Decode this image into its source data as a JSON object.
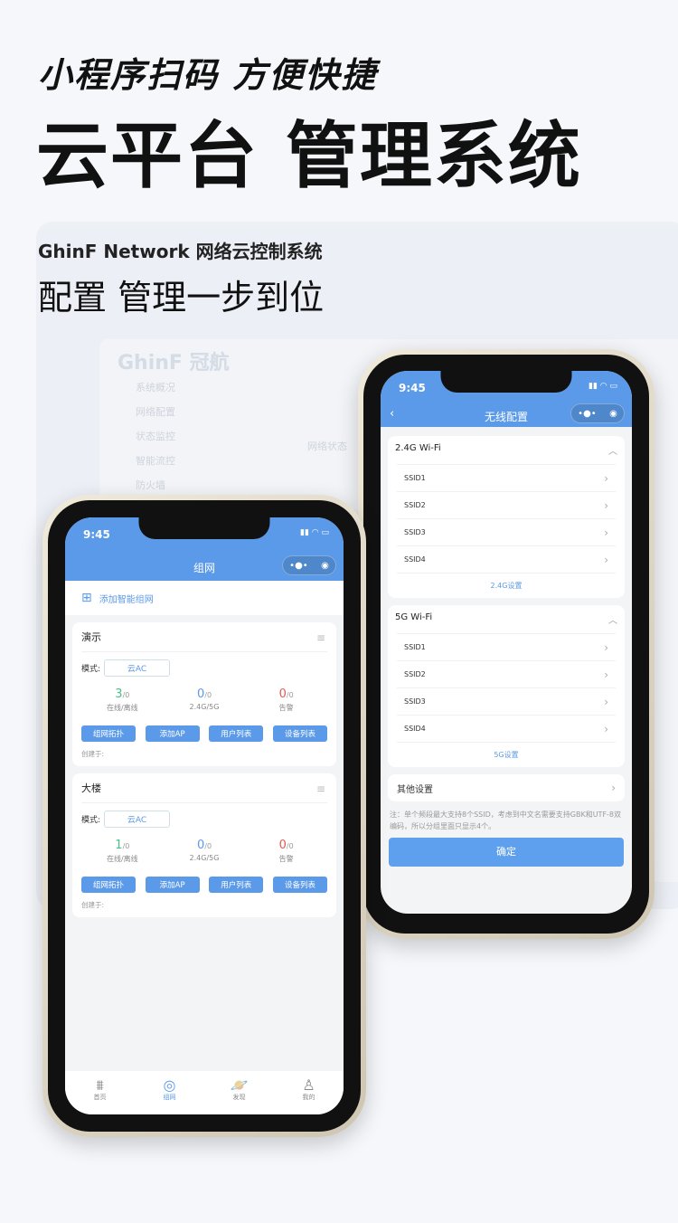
{
  "headline": {
    "line1": "小程序扫码 方便快捷",
    "line2": "云平台 管理系统"
  },
  "subtitle": {
    "line1": "GhinF Network 网络云控制系统",
    "line2": "配置 管理一步到位"
  },
  "background_dashboard": {
    "logo": "GhinF 冠航",
    "sidebar": [
      "系统概况",
      "网络配置",
      "状态监控",
      "智能流控",
      "防火墙"
    ],
    "status": "网络状态"
  },
  "phone1": {
    "time": "9:45",
    "title": "组网",
    "capsule": "•●•",
    "add_label": "添加智能组网",
    "groups": [
      {
        "name": "演示",
        "mode_label": "模式:",
        "mode": "云AC",
        "stats": [
          {
            "value": "3",
            "total": "/0",
            "label": "在线/离线",
            "color": "#4cbf8a"
          },
          {
            "value": "0",
            "total": "/0",
            "label": "2.4G/5G",
            "color": "#5b9ae8"
          },
          {
            "value": "0",
            "total": "/0",
            "label": "告警",
            "color": "#e05a4f"
          }
        ],
        "buttons": [
          "组网拓扑",
          "添加AP",
          "用户列表",
          "设备列表"
        ],
        "created": "创建于:"
      },
      {
        "name": "大楼",
        "mode_label": "模式:",
        "mode": "云AC",
        "stats": [
          {
            "value": "1",
            "total": "/0",
            "label": "在线/离线",
            "color": "#4cbf8a"
          },
          {
            "value": "0",
            "total": "/0",
            "label": "2.4G/5G",
            "color": "#5b9ae8"
          },
          {
            "value": "0",
            "total": "/0",
            "label": "告警",
            "color": "#e05a4f"
          }
        ],
        "buttons": [
          "组网拓扑",
          "添加AP",
          "用户列表",
          "设备列表"
        ],
        "created": "创建于:"
      }
    ],
    "tabs": [
      {
        "label": "首页",
        "icon": "router-icon"
      },
      {
        "label": "组网",
        "icon": "signal-icon",
        "active": true
      },
      {
        "label": "发现",
        "icon": "planet-icon"
      },
      {
        "label": "我的",
        "icon": "user-icon"
      }
    ]
  },
  "phone2": {
    "time": "9:45",
    "title": "无线配置",
    "bands": [
      {
        "name": "2.4G Wi-Fi",
        "ssids": [
          "SSID1",
          "SSID2",
          "SSID3",
          "SSID4"
        ],
        "link": "2.4G设置"
      },
      {
        "name": "5G Wi-Fi",
        "ssids": [
          "SSID1",
          "SSID2",
          "SSID3",
          "SSID4"
        ],
        "link": "5G设置"
      }
    ],
    "other": "其他设置",
    "note": "注：单个频段最大支持8个SSID，考虑到中文名需要支持GBK和UTF-8双编码，所以分组里面只显示4个。",
    "confirm": "确定"
  },
  "colors": {
    "accent": "#5b9ae8"
  }
}
